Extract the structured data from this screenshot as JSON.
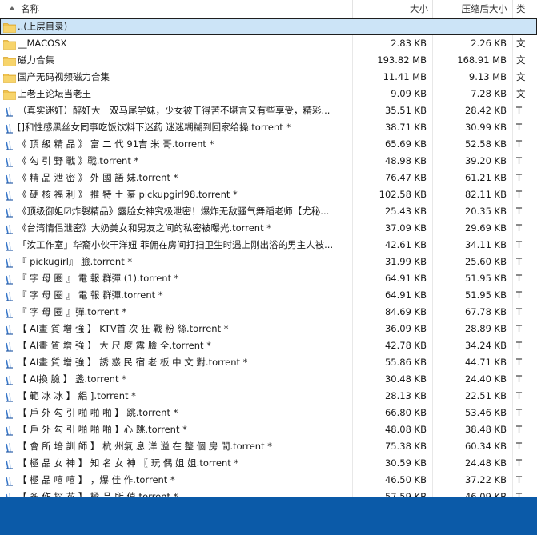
{
  "columns": {
    "name": "名称",
    "size": "大小",
    "packed": "压缩后大小",
    "type": "类"
  },
  "rows": [
    {
      "kind": "folder",
      "name": "..(上层目录)",
      "size": "",
      "packed": "",
      "type": ""
    },
    {
      "kind": "folder",
      "name": "__MACOSX",
      "size": "2.83 KB",
      "packed": "2.26 KB",
      "type": "文"
    },
    {
      "kind": "folder",
      "name": "磁力合集",
      "size": "193.82 MB",
      "packed": "168.91 MB",
      "type": "文"
    },
    {
      "kind": "folder",
      "name": "国产无码视频磁力合集",
      "size": "11.41 MB",
      "packed": "9.13 MB",
      "type": "文"
    },
    {
      "kind": "folder",
      "name": "上老王论坛当老王",
      "size": "9.09 KB",
      "packed": "7.28 KB",
      "type": "文"
    },
    {
      "kind": "file",
      "name": "（真实迷奸）醉奸大一双马尾学妹，少女被干得苦不堪言又有些享受，精彩...",
      "size": "35.51 KB",
      "packed": "28.42 KB",
      "type": "T"
    },
    {
      "kind": "file",
      "name": "[]和性感黑丝女同事吃饭饮料下迷药 迷迷糊糊到回家给操.torrent *",
      "size": "38.71 KB",
      "packed": "30.99 KB",
      "type": "T"
    },
    {
      "kind": "file",
      "name": "《 頂 級 精 品 》 富 二 代 91吉 米 哥.torrent *",
      "size": "65.69 KB",
      "packed": "52.58 KB",
      "type": "T"
    },
    {
      "kind": "file",
      "name": "《 勾 引 野 戰 》戰.torrent *",
      "size": "48.98 KB",
      "packed": "39.20 KB",
      "type": "T"
    },
    {
      "kind": "file",
      "name": "《 精 品 泄 密 》 外 國 語 妹.torrent *",
      "size": "76.47 KB",
      "packed": "61.21 KB",
      "type": "T"
    },
    {
      "kind": "file",
      "name": "《 硬 核 福 利 》 推 特 土 豪 pickupgirl98.torrent *",
      "size": "102.58 KB",
      "packed": "82.11 KB",
      "type": "T"
    },
    {
      "kind": "file",
      "name": "《顶级御姐☑炸裂精品》露脸女神究极泄密！爆炸无敌骚气舞蹈老师【尤秘...",
      "size": "25.43 KB",
      "packed": "20.35 KB",
      "type": "T"
    },
    {
      "kind": "file",
      "name": "《台湾情侣泄密》大奶美女和男友之间的私密被曝光.torrent *",
      "size": "37.09 KB",
      "packed": "29.69 KB",
      "type": "T"
    },
    {
      "kind": "file",
      "name": "「汝工作室」华裔小伙干洋妞 菲佣在房间打扫卫生时遇上刚出浴的男主人被...",
      "size": "42.61 KB",
      "packed": "34.11 KB",
      "type": "T"
    },
    {
      "kind": "file",
      "name": "『 pickugirl』 臉.torrent *",
      "size": "31.99 KB",
      "packed": "25.60 KB",
      "type": "T"
    },
    {
      "kind": "file",
      "name": "『 字 母 圈 』 電 報 群彈 (1).torrent *",
      "size": "64.91 KB",
      "packed": "51.95 KB",
      "type": "T"
    },
    {
      "kind": "file",
      "name": "『 字 母 圈 』 電 報 群彈.torrent *",
      "size": "64.91 KB",
      "packed": "51.95 KB",
      "type": "T"
    },
    {
      "kind": "file",
      "name": "『 字 母 圈 』彈.torrent *",
      "size": "84.69 KB",
      "packed": "67.78 KB",
      "type": "T"
    },
    {
      "kind": "file",
      "name": "【 AI畫 質 增 強 】 KTV首 次 狂 戰 粉 絲.torrent *",
      "size": "36.09 KB",
      "packed": "28.89 KB",
      "type": "T"
    },
    {
      "kind": "file",
      "name": "【 AI畫 質 增 強 】 大 尺 度 露 臉 全.torrent *",
      "size": "42.78 KB",
      "packed": "34.24 KB",
      "type": "T"
    },
    {
      "kind": "file",
      "name": "【 AI畫 質 增 強 】 誘 惑 民 宿 老 板 中 文 對.torrent *",
      "size": "55.86 KB",
      "packed": "44.71 KB",
      "type": "T"
    },
    {
      "kind": "file",
      "name": "【 AI換 臉 】 盞.torrent *",
      "size": "30.48 KB",
      "packed": "24.40 KB",
      "type": "T"
    },
    {
      "kind": "file",
      "name": "【 範 冰 冰 】 絽 ].torrent *",
      "size": "28.13 KB",
      "packed": "22.51 KB",
      "type": "T"
    },
    {
      "kind": "file",
      "name": "【 戶 外 勾 引 啪 啪 啪 】 跳.torrent *",
      "size": "66.80 KB",
      "packed": "53.46 KB",
      "type": "T"
    },
    {
      "kind": "file",
      "name": "【 戶 外 勾 引 啪 啪 啪 】心 跳.torrent *",
      "size": "48.08 KB",
      "packed": "38.48 KB",
      "type": "T"
    },
    {
      "kind": "file",
      "name": "【 會 所 培 訓 師 】 杭 州氣 息 洋 溢 在 整 個 房 間.torrent *",
      "size": "75.38 KB",
      "packed": "60.34 KB",
      "type": "T"
    },
    {
      "kind": "file",
      "name": "【 極 品 女 神 】 知 名 女 神 〖 玩 偶 姐 姐.torrent *",
      "size": "30.59 KB",
      "packed": "24.48 KB",
      "type": "T"
    },
    {
      "kind": "file",
      "name": "【 極 品 嘻 嘻 】 ，爆 佳 作.torrent *",
      "size": "46.50 KB",
      "packed": "37.22 KB",
      "type": "T"
    },
    {
      "kind": "file",
      "name": "【 多 作 探 花 】 極 品 所 值.torrent *",
      "size": "57.59 KB",
      "packed": "46.09 KB",
      "type": "T"
    }
  ]
}
